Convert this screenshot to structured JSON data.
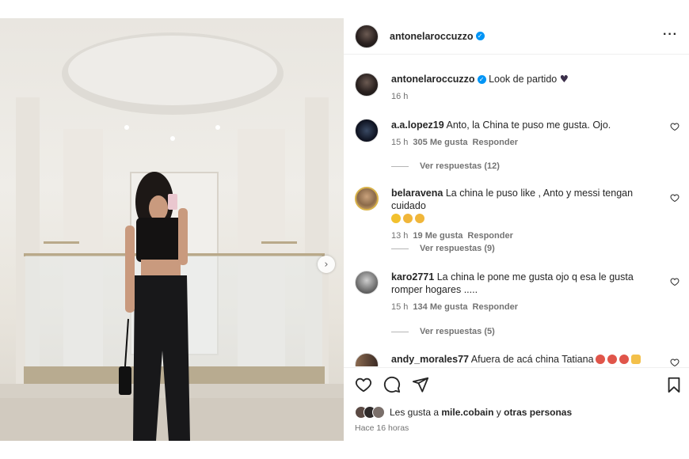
{
  "post": {
    "author": "antonelaroccuzzo",
    "caption": {
      "username": "antonelaroccuzzo",
      "text": "Look de partido",
      "emoji": "black-heart",
      "time": "16 h"
    }
  },
  "comments": [
    {
      "username": "a.a.lopez19",
      "text": "Anto, la China te puso me gusta. Ojo.",
      "time": "15 h",
      "likes": "305 Me gusta",
      "reply_label": "Responder",
      "view_replies": "Ver respuestas (12)"
    },
    {
      "username": "belaravena",
      "text": "La china le puso like , Anto y messi tengan cuidado",
      "emojis": [
        "laughing-face",
        "cat-face",
        "cat-face"
      ],
      "time": "13 h",
      "likes": "19 Me gusta",
      "reply_label": "Responder",
      "view_replies": "Ver respuestas (9)"
    },
    {
      "username": "karo2771",
      "text": "La china le pone me gusta ojo q esa le gusta romper hogares .....",
      "time": "15 h",
      "likes": "134 Me gusta",
      "reply_label": "Responder",
      "view_replies": "Ver respuestas (5)"
    },
    {
      "username": "andy_morales77",
      "text": "Afuera de acá china Tatiana",
      "emojis": [
        "angry-face",
        "angry-face",
        "angry-face",
        "clap-hands"
      ]
    }
  ],
  "likes_summary": {
    "prefix": "Les gusta a",
    "user": "mile.cobain",
    "connector": "y",
    "others": "otras personas"
  },
  "posted_ago": "Hace 16 horas",
  "icons": [
    "heart-icon",
    "comment-icon",
    "share-icon",
    "bookmark-icon",
    "more-icon",
    "chevron-right-icon",
    "verified-icon"
  ],
  "colors": {
    "verified": "#0095f6",
    "muted": "#737373",
    "text": "#262626"
  }
}
